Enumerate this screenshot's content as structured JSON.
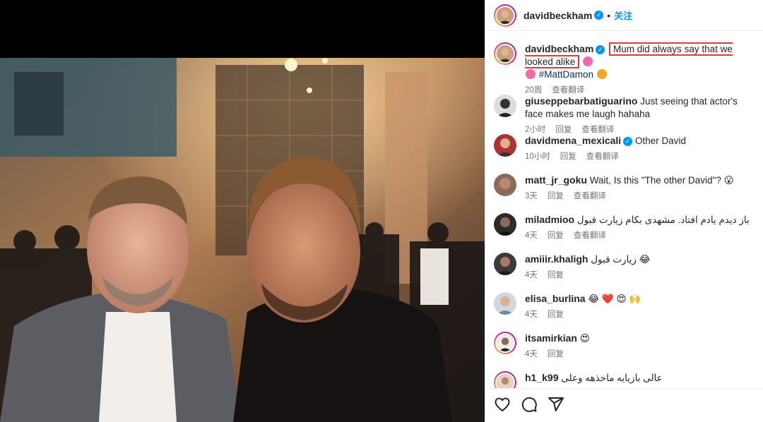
{
  "post": {
    "username": "davidbeckham",
    "dot": "•",
    "follow_label": "关注"
  },
  "caption": {
    "username": "davidbeckham",
    "text": "Mum did always say that we looked alike",
    "hashtag": "#MattDamon",
    "time": "20周",
    "translate": "查看翻译"
  },
  "comments": [
    {
      "username": "giuseppebarbatiguarino",
      "text": "Just seeing that actor's face makes me laugh hahaha",
      "time": "2小时",
      "reply": "回复",
      "translate": "查看翻译"
    },
    {
      "username": "davidmena_mexicali",
      "verified": true,
      "text": "Other David",
      "time": "10小时",
      "reply": "回复",
      "translate": "查看翻译"
    },
    {
      "username": "matt_jr_goku",
      "text": "Wait, Is this \"The other David\"? 😮",
      "time": "3天",
      "reply": "回复",
      "translate": "查看翻译"
    },
    {
      "username": "miladmioo",
      "text": "باز دیدم یادم افتاد. مشهدی بکام زیارت قبول",
      "time": "4天",
      "reply": "回复",
      "translate": "查看翻译"
    },
    {
      "username": "amiiir.khaligh",
      "text": "😂 زیارت قبول",
      "time": "4天",
      "reply": "回复"
    },
    {
      "username": "elisa_burlina",
      "text": "😂 ❤️ 😍 🙌",
      "time": "4天",
      "reply": "回复"
    },
    {
      "username": "itsamirkian",
      "text": "😍",
      "time": "4天",
      "reply": "回复"
    },
    {
      "username": "h1_k99",
      "text": "عالی بازیایه ماخذهه وعلی",
      "time": "",
      "reply": ""
    }
  ],
  "colors": {
    "accent": "#0095f6",
    "highlight_border": "#e53935",
    "meta_text": "#737373"
  },
  "icons": [
    "heart-icon",
    "comment-icon",
    "share-icon",
    "verified-icon"
  ]
}
